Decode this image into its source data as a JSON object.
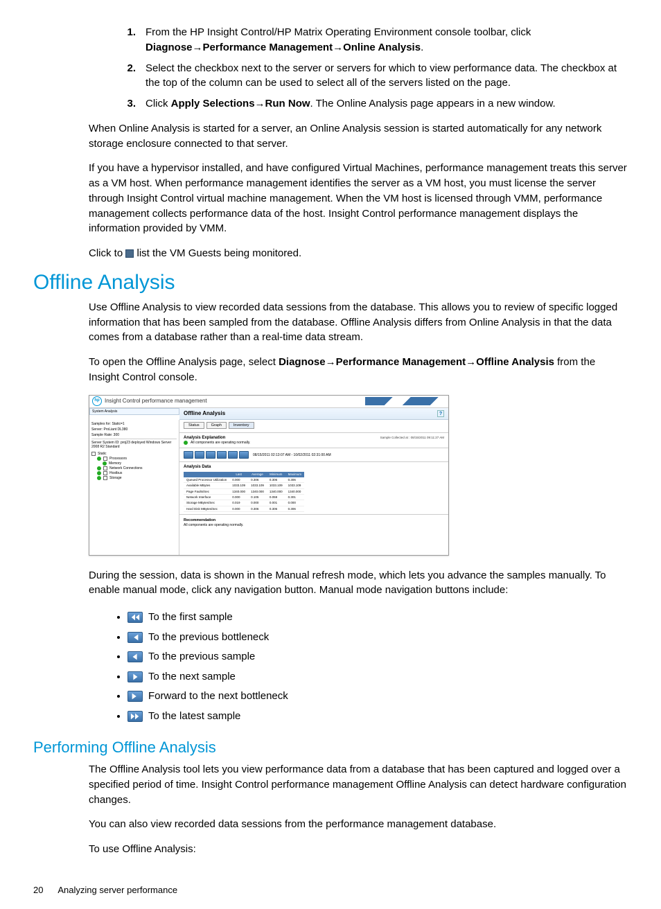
{
  "steps": [
    {
      "num": "1.",
      "pre": "From the HP Insight Control/HP Matrix Operating Environment console toolbar, click ",
      "bold": "Diagnose→Performance Management→Online Analysis",
      "post": "."
    },
    {
      "num": "2.",
      "pre": "Select the checkbox next to the server or servers for which to view performance data. The checkbox at the top of the column can be used to select all of the servers listed on the page.",
      "bold": "",
      "post": ""
    },
    {
      "num": "3.",
      "pre": "Click ",
      "bold": "Apply Selections→Run Now",
      "post": ". The Online Analysis page appears in a new window."
    }
  ],
  "para_after_steps_1": "When Online Analysis is started for a server, an Online Analysis session is started automatically for any network storage enclosure connected to that server.",
  "para_after_steps_2": "If you have a hypervisor installed, and have configured Virtual Machines, performance management treats this server as a VM host. When performance management identifies the server as a VM host, you must license the server through Insight Control virtual machine management. When the VM host is licensed through VMM, performance management collects performance data of the host. Insight Control performance management displays the information provided by VMM.",
  "para_click_pre": "Click to ",
  "para_click_post": " list the VM Guests being monitored.",
  "h1_offline": "Offline Analysis",
  "offline_p1": "Use Offline Analysis to view recorded data sessions from the database. This allows you to review of specific logged information that has been sampled from the database. Offline Analysis differs from Online Analysis in that the data comes from a database rather than a real-time data stream.",
  "offline_p2_pre": "To open the Offline Analysis page, select ",
  "offline_p2_bold": "Diagnose→Performance Management→Offline Analysis",
  "offline_p2_post": " from the Insight Control console.",
  "offline_p3": "During the session, data is shown in the Manual refresh mode, which lets you advance the samples manually. To enable manual mode, click any navigation button. Manual mode navigation buttons include:",
  "navlist": [
    "To the first sample",
    "To the previous bottleneck",
    "To the previous sample",
    "To the next sample",
    "Forward to the next bottleneck",
    "To the latest sample"
  ],
  "h2_performing": "Performing Offline Analysis",
  "perf_p1": "The Offline Analysis tool lets you view performance data from a database that has been captured and logged over a specified period of time. Insight Control performance management Offline Analysis can detect hardware configuration changes.",
  "perf_p2": "You can also view recorded data sessions from the performance management database.",
  "perf_p3": "To use Offline Analysis:",
  "footer_page": "20",
  "footer_title": "Analyzing server performance",
  "figure": {
    "app_title": "Insight Control performance management",
    "crumb": "System Analysis",
    "panel_title": "Offline Analysis",
    "side_samples_for": "Samples for: Static=1",
    "side_server": "Server: ProLiant DL380",
    "side_rate": "Sample Rate: 300",
    "side_desc": "Server System ID: proj23 deployed Windows Server 2008 R2 Standard",
    "tree": [
      "Static",
      "Processors",
      "Memory",
      "Network Connections",
      "Hostbus",
      "Storage"
    ],
    "tabs": [
      "Status",
      "Graph",
      "Inventory"
    ],
    "selected_tab": "Inventory",
    "expl_title": "Analysis Explanation",
    "expl_text": "All components are operating normally.",
    "timestamp": "08/15/2011 02:13:07 AM - 10/02/2011 02:31:00 AM",
    "sample_collected": "Sample Collected at : 08/15/2011 09:11:27 AM",
    "table_head": [
      "",
      "Last",
      "Average",
      "Minimum",
      "Maximum"
    ],
    "table_rows": [
      [
        "Queued Processor Utilization",
        "0.000",
        "0.306",
        "0.306",
        "0.306"
      ],
      [
        "Available MBytes",
        "1033.109",
        "1033.109",
        "1033.109",
        "1033.109"
      ],
      [
        "Page Faults/Sec",
        "1340.000",
        "1340.000",
        "1340.000",
        "1340.000"
      ],
      [
        "Network Interface",
        "0.000",
        "0.105",
        "0.059",
        "0.301"
      ],
      [
        "Storage MBytes/Sec",
        "0.019",
        "0.000",
        "0.001",
        "0.000"
      ],
      [
        "Hard Disk MBytes/Sec",
        "0.000",
        "0.306",
        "0.306",
        "0.306"
      ]
    ],
    "reco_title": "Recommendation",
    "reco_text": "All components are operating normally."
  }
}
